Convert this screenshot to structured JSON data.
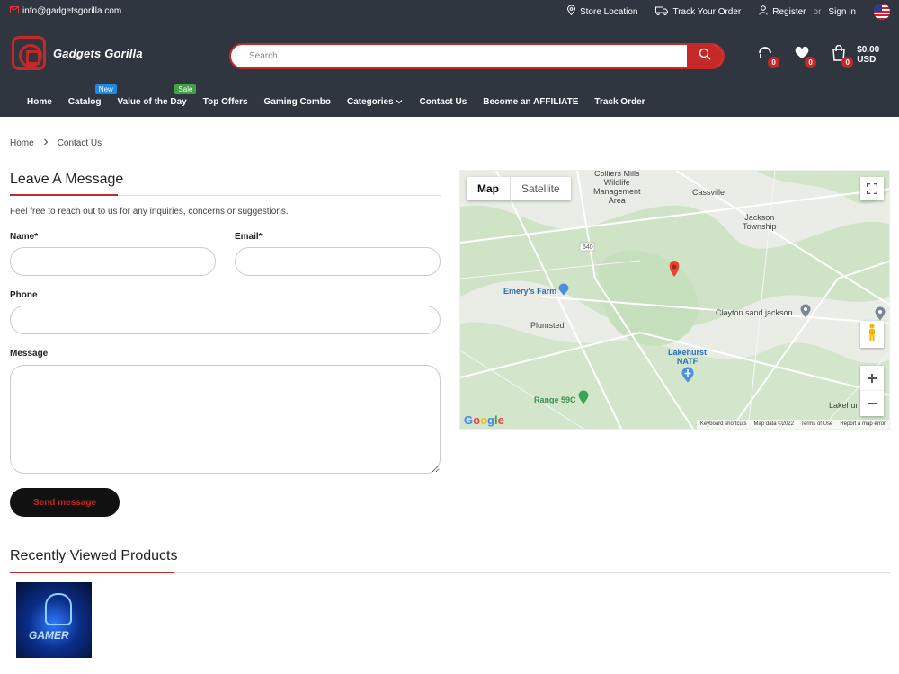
{
  "topbar": {
    "email": "info@gadgetsgorilla.com",
    "store_location": "Store Location",
    "track_order": "Track Your Order",
    "register": "Register",
    "or": "or",
    "sign_in": "Sign in"
  },
  "header": {
    "logo_text": "Gadgets Gorilla",
    "search_placeholder": "Search",
    "compare_count": "0",
    "wishlist_count": "0",
    "cart_count": "0",
    "cart_total": "$0.00 USD"
  },
  "nav": {
    "items": [
      "Home",
      "Catalog",
      "Value of the Day",
      "Top Offers",
      "Gaming Combo",
      "Categories",
      "Contact Us",
      "Become an AFFILIATE",
      "Track Order"
    ],
    "tag_new": "New",
    "tag_sale": "Sale"
  },
  "breadcrumb": {
    "home": "Home",
    "current": "Contact Us"
  },
  "form": {
    "title": "Leave A Message",
    "description": "Feel free to reach out to us for any inquiries, concerns or suggestions.",
    "name_label": "Name*",
    "email_label": "Email*",
    "phone_label": "Phone",
    "message_label": "Message",
    "send_label": "Send message"
  },
  "map": {
    "tab_map": "Map",
    "tab_satellite": "Satellite",
    "labels": {
      "colliers": "Colliers Mills\nWildlife\nManagement\nArea",
      "cassville": "Cassville",
      "jackson": "Jackson\nTownship",
      "route": "640",
      "emerys": "Emery's Farm",
      "plumsted": "Plumsted",
      "clayton": "Clayton sand jackson",
      "lakehurst": "Lakehurst\nNATF",
      "range": "Range 59C",
      "lakehurst2": "Lakehur"
    },
    "footer": [
      "Keyboard shortcuts",
      "Map data ©2022",
      "Terms of Use",
      "Report a map error"
    ],
    "google": "Google"
  },
  "recent": {
    "title": "Recently Viewed Products",
    "product_text": "GAMER"
  }
}
